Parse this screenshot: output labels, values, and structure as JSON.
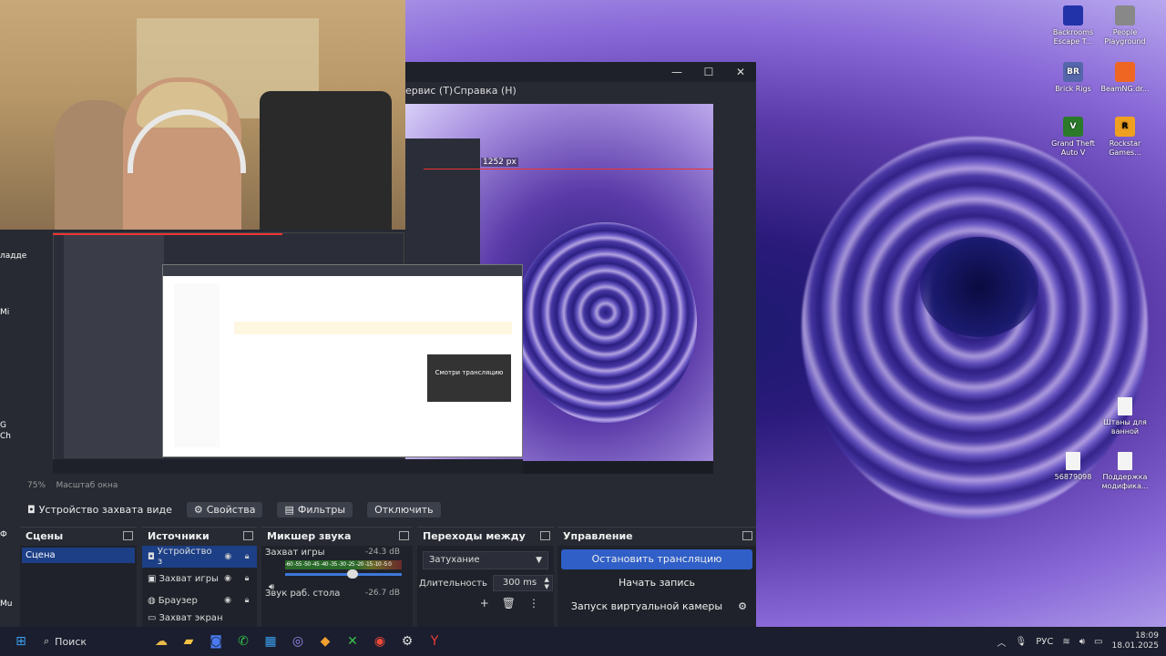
{
  "desktop": {
    "icons": [
      {
        "label": "Backrooms Escape T...",
        "badge": "",
        "color": "#2233aa"
      },
      {
        "label": "People Playground",
        "badge": "",
        "color": "#888888"
      },
      {
        "label": "Brick Rigs",
        "badge": "BR",
        "color": "#5566aa"
      },
      {
        "label": "BeamNG.dr...",
        "badge": "",
        "color": "#ee6622"
      },
      {
        "label": "Grand Theft Auto V",
        "badge": "V",
        "color": "#2a7a2a"
      },
      {
        "label": "Rockstar Games...",
        "badge": "R",
        "color": "#f0a020"
      },
      {
        "label": "Штаны для ванной",
        "badge": "",
        "color": "#f4f4f4"
      },
      {
        "label": "56879098",
        "badge": "",
        "color": "#f4f4f4"
      },
      {
        "label": "Поддержка модифика...",
        "badge": "",
        "color": "#f4f4f4"
      }
    ],
    "left_cut_labels": [
      "ладде",
      "Mi",
      "G",
      "Ch",
      "Mu",
      "Ф"
    ]
  },
  "obs": {
    "menu": [
      "ервис (T)",
      "Справка (H)"
    ],
    "window_buttons": {
      "minimize": "—",
      "maximize": "☐",
      "close": "✕"
    },
    "preview_measure": "1252 px",
    "nested_card": "Смотри трансляцию",
    "zoom": "75%",
    "zoom_label": "Масштаб окна",
    "source_toolbar": {
      "source_name": "Устройство захвата виде",
      "properties": "Свойства",
      "filters": "Фильтры",
      "disable": "Отключить"
    },
    "docks": {
      "scenes": {
        "title": "Сцены",
        "items": [
          "Сцена"
        ]
      },
      "sources": {
        "title": "Источники",
        "items": [
          "Устройство з",
          "Захват игры",
          "Браузер",
          "Захват экран"
        ]
      },
      "mixer": {
        "title": "Микшер звука",
        "channels": [
          {
            "name": "Захват игры",
            "db": "-24.3 dB",
            "scale": "-60 -55 -50 -45 -40 -35 -30 -25 -20 -15 -10 -5 0"
          },
          {
            "name": "Звук раб. стола",
            "db": "-26.7 dB"
          }
        ]
      },
      "transitions": {
        "title": "Переходы между сцен...",
        "selected": "Затухание",
        "duration_label": "Длительность",
        "duration": "300 ms"
      },
      "controls": {
        "title": "Управление",
        "stop_stream": "Остановить трансляцию",
        "start_record": "Начать запись",
        "virtual_cam": "Запуск виртуальной камеры"
      }
    }
  },
  "taskbar": {
    "search_placeholder": "Поиск",
    "lang": "РУС",
    "time": "18:09",
    "date": "18.01.2025"
  },
  "colors": {
    "accent": "#2f5fc7",
    "selected": "#1c3f86",
    "dock_bg": "#1f222a"
  }
}
